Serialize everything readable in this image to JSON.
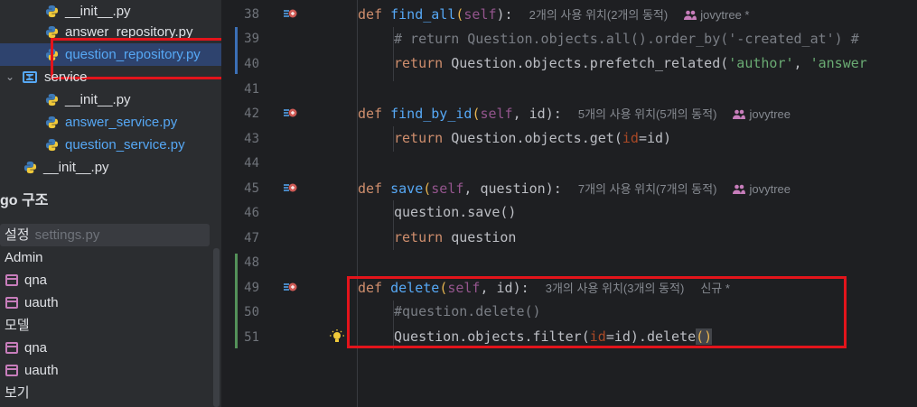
{
  "project_tree": {
    "items": [
      {
        "label": "__init__.py",
        "color": "normal"
      },
      {
        "label": "answer_repository.py",
        "color": "normal"
      },
      {
        "label": "question_repository.py",
        "color": "blue"
      },
      {
        "label": "service",
        "color": "normal"
      },
      {
        "label": "__init__.py",
        "color": "normal"
      },
      {
        "label": "answer_service.py",
        "color": "blue"
      },
      {
        "label": "question_service.py",
        "color": "blue"
      },
      {
        "label": "__init__.py",
        "color": "normal"
      }
    ]
  },
  "structure_panel": {
    "title": "go 구조",
    "rows": [
      {
        "label": "설정",
        "muted": "settings.py"
      },
      {
        "label": "Admin"
      },
      {
        "label": "qna"
      },
      {
        "label": "uauth"
      },
      {
        "label": "모델"
      },
      {
        "label": "qna"
      },
      {
        "label": "uauth"
      },
      {
        "label": "보기"
      }
    ]
  },
  "editor": {
    "lines": [
      {
        "num": "38",
        "def": "def",
        "name": "find_all",
        "open": "(",
        "self": "self",
        "close": "):",
        "hint": "2개의 사용 위치(2개의 동적)",
        "author": "jovytree *"
      },
      {
        "num": "39",
        "text": "# return Question.objects.all().order_by('-created_at') #"
      },
      {
        "num": "40",
        "ret": "return",
        "body": " Question.objects.prefetch_related(",
        "s1": "'author'",
        "sep": ", ",
        "s2": "'answer"
      },
      {
        "num": "41"
      },
      {
        "num": "42",
        "def": "def",
        "name": "find_by_id",
        "open": "(",
        "self": "self",
        "mid": ", id",
        "close": "):",
        "hint": "5개의 사용 위치(5개의 동적)",
        "author": "jovytree"
      },
      {
        "num": "43",
        "ret": "return",
        "body": " Question.objects.get(",
        "kw": "id",
        "tail": "=id)"
      },
      {
        "num": "44"
      },
      {
        "num": "45",
        "def": "def",
        "name": "save",
        "open": "(",
        "self": "self",
        "mid": ", question",
        "close": "):",
        "hint": "7개의 사용 위치(7개의 동적)",
        "author": "jovytree"
      },
      {
        "num": "46",
        "text": "question.save()"
      },
      {
        "num": "47",
        "ret": "return",
        "body": " question"
      },
      {
        "num": "48"
      },
      {
        "num": "49",
        "def": "def",
        "name": "delete",
        "open": "(",
        "self": "self",
        "mid": ", id",
        "close": "):",
        "hint": "3개의 사용 위치(3개의 동적)",
        "author": "신규 *"
      },
      {
        "num": "50",
        "text": "#question.delete()"
      },
      {
        "num": "51",
        "body": "Question.objects.filter(",
        "kw": "id",
        "tail": "=id).delete",
        "cursor": "()"
      }
    ]
  },
  "colors": {
    "highlight_box": "#e3141b",
    "keyword": "#cf8e6d",
    "function": "#56a8f5",
    "string": "#6aab73"
  },
  "icons": [
    "python-file-icon",
    "package-icon",
    "module-icon",
    "override-method-icon",
    "user-icon",
    "lightbulb-icon"
  ]
}
